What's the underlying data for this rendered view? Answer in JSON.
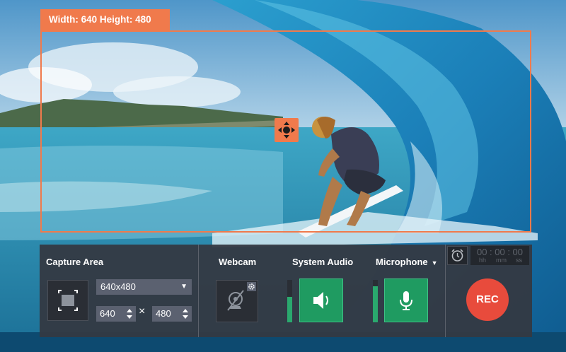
{
  "overlay": {
    "dimensions_label": "Width: 640  Height: 480",
    "accent_color": "#f07a4c"
  },
  "capture_area": {
    "title": "Capture Area",
    "preset": "640x480",
    "width_value": "640",
    "height_value": "480",
    "separator": "×"
  },
  "webcam": {
    "title": "Webcam",
    "state": "disabled"
  },
  "system_audio": {
    "title": "System Audio",
    "level": 0.6
  },
  "microphone": {
    "title": "Microphone",
    "level": 0.85
  },
  "timer": {
    "display": "00 : 00 : 00",
    "units": [
      "hh",
      "mm",
      "ss"
    ]
  },
  "rec_label": "REC",
  "colors": {
    "green": "#1f9b61",
    "rec": "#e84b3c",
    "panel": "#343942"
  },
  "icons": [
    "area-select-icon",
    "move-icon",
    "webcam-off-icon",
    "gear-icon",
    "speaker-icon",
    "microphone-icon",
    "alarm-clock-icon"
  ]
}
